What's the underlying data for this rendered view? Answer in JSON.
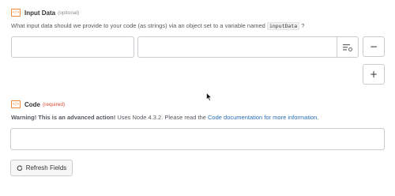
{
  "input_data": {
    "icon": "code-icon",
    "icon_glyph": "</>",
    "title": "Input Data",
    "badge": "(optional)",
    "help_before": "What input data should we provide to your code (as strings) via an object set to a variable named",
    "help_code": "inputData",
    "help_after": "?",
    "key_value": "",
    "value_value": "",
    "select_icon": "list-gear-icon",
    "remove_label": "−",
    "add_label": "+"
  },
  "code": {
    "icon": "code-icon",
    "icon_glyph": "</>",
    "title": "Code",
    "badge": "(required)",
    "warning": "Warning! This is an advanced action!",
    "help_text": "Uses Node 4.3.2. Please read the",
    "link_text": "Code documentation for more information",
    "help_end": ".",
    "value": ""
  },
  "refresh_button": {
    "icon": "refresh-icon",
    "label": "Refresh Fields"
  },
  "colors": {
    "accent": "#f08a3a",
    "required": "#d94a32",
    "link": "#2a6fb8",
    "border": "#c9ccd0"
  }
}
